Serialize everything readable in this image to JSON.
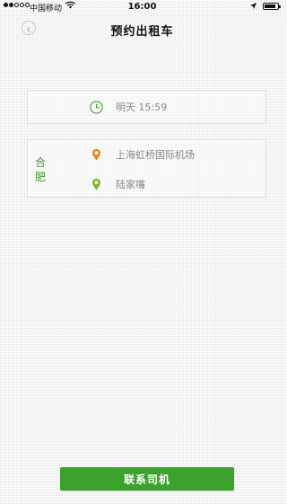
{
  "status_bar": {
    "carrier": "中国移动",
    "time": "16:00",
    "battery_level": 0.85
  },
  "nav": {
    "title": "预约出租车"
  },
  "booking": {
    "time_text": "明天 15:59",
    "city": "合肥",
    "origin": "上海虹桥国际机场",
    "destination": "陆家嘴"
  },
  "actions": {
    "contact_driver_label": "联系司机"
  },
  "colors": {
    "accent_green": "#3ba22c",
    "origin_pin": "#e58b1e",
    "destination_pin": "#7cb82f"
  },
  "icons": {
    "back": "chevron-left-icon",
    "clock": "clock-icon",
    "origin": "map-pin-icon",
    "destination": "map-pin-icon"
  }
}
